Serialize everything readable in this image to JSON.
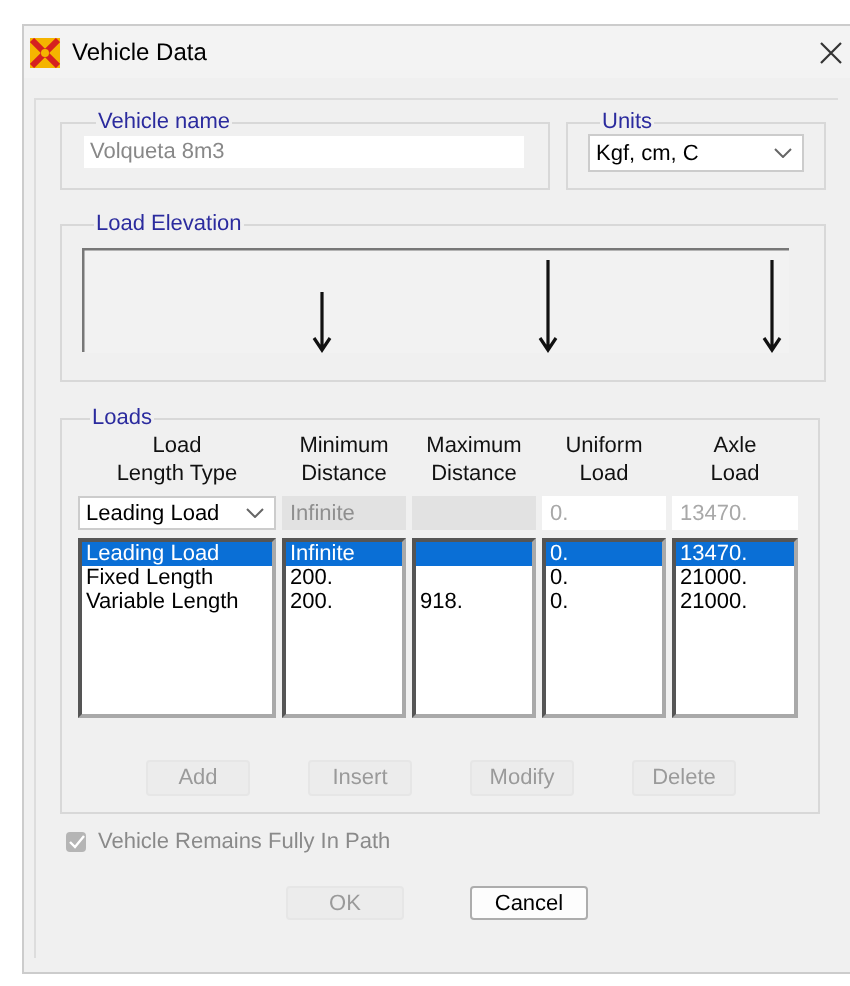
{
  "window": {
    "title": "Vehicle Data"
  },
  "vehicle_name": {
    "label": "Vehicle name",
    "value": "Volqueta 8m3",
    "disabled": true
  },
  "units": {
    "label": "Units",
    "value": "Kgf, cm, C"
  },
  "load_elevation": {
    "label": "Load Elevation"
  },
  "loads": {
    "label": "Loads",
    "columns": [
      {
        "heading_lines": [
          "Load",
          "Length Type"
        ]
      },
      {
        "heading_lines": [
          "Minimum",
          "Distance"
        ]
      },
      {
        "heading_lines": [
          "Maximum",
          "Distance"
        ]
      },
      {
        "heading_lines": [
          "Uniform",
          "Load"
        ]
      },
      {
        "heading_lines": [
          "Axle",
          "Load"
        ]
      }
    ],
    "edit_row": [
      {
        "kind": "dropdown",
        "value": "Leading Load"
      },
      {
        "kind": "field",
        "value": "Infinite",
        "disabled": true
      },
      {
        "kind": "field",
        "disabled": true
      },
      {
        "kind": "field",
        "value": "0.",
        "disabled": false
      },
      {
        "kind": "field",
        "value": "13470.",
        "disabled": false
      }
    ],
    "rows": [
      {
        "load_length_type": "Leading Load",
        "minimum_distance": "Infinite",
        "uniform_load": "0.",
        "axle_load": "13470.",
        "selected": true
      },
      {
        "load_length_type": "Fixed Length",
        "minimum_distance": "200.",
        "uniform_load": "0.",
        "axle_load": "21000.",
        "selected": false
      },
      {
        "load_length_type": "Variable Length",
        "minimum_distance": "200.",
        "maximum_distance": "918.",
        "uniform_load": "0.",
        "axle_load": "21000.",
        "selected": false
      }
    ],
    "buttons": [
      {
        "label": "Add",
        "disabled": true
      },
      {
        "label": "Insert",
        "disabled": true
      },
      {
        "label": "Modify",
        "disabled": true
      },
      {
        "label": "Delete",
        "disabled": true
      }
    ]
  },
  "vehicle_remains_fully_in_path": {
    "label": "Vehicle Remains Fully In Path",
    "checked": true,
    "disabled": true
  },
  "dialog_buttons": [
    {
      "label": "OK",
      "disabled": true
    },
    {
      "label": "Cancel",
      "disabled": false
    }
  ]
}
